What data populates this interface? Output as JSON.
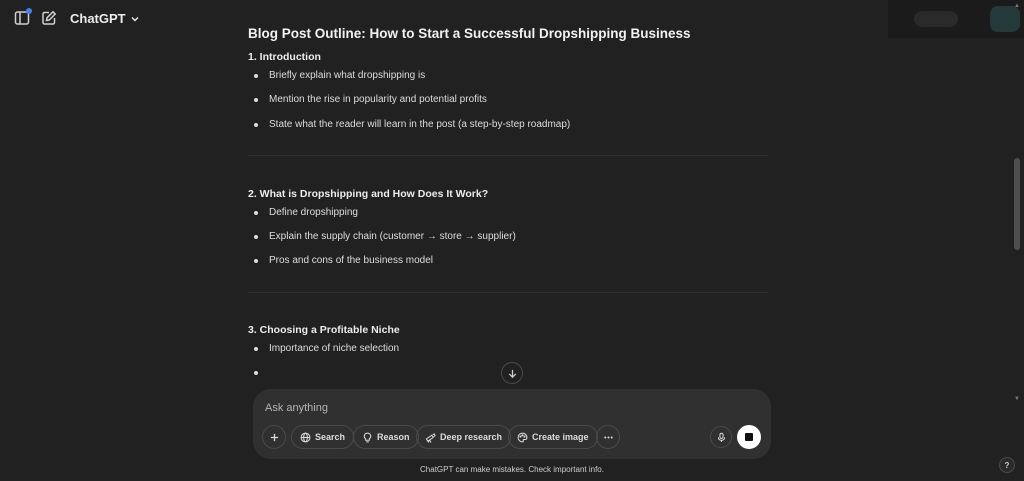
{
  "header": {
    "model_name": "ChatGPT"
  },
  "document": {
    "title": "Blog Post Outline: How to Start a Successful Dropshipping Business",
    "sections": [
      {
        "heading": "1. Introduction",
        "bullets": [
          "Briefly explain what dropshipping is",
          "Mention the rise in popularity and potential profits",
          "State what the reader will learn in the post (a step-by-step roadmap)"
        ]
      },
      {
        "heading": "2. What is Dropshipping and How Does It Work?",
        "bullets": [
          "Define dropshipping",
          "Explain the supply chain (customer → store → supplier)",
          "Pros and cons of the business model"
        ]
      },
      {
        "heading": "3. Choosing a Profitable Niche",
        "bullets": [
          "Importance of niche selection"
        ]
      }
    ]
  },
  "composer": {
    "placeholder": "Ask anything",
    "tools": {
      "search": "Search",
      "reason": "Reason",
      "deep_research": "Deep research",
      "create_image": "Create image"
    }
  },
  "footer": {
    "disclaimer": "ChatGPT can make mistakes. Check important info."
  },
  "help_label": "?"
}
